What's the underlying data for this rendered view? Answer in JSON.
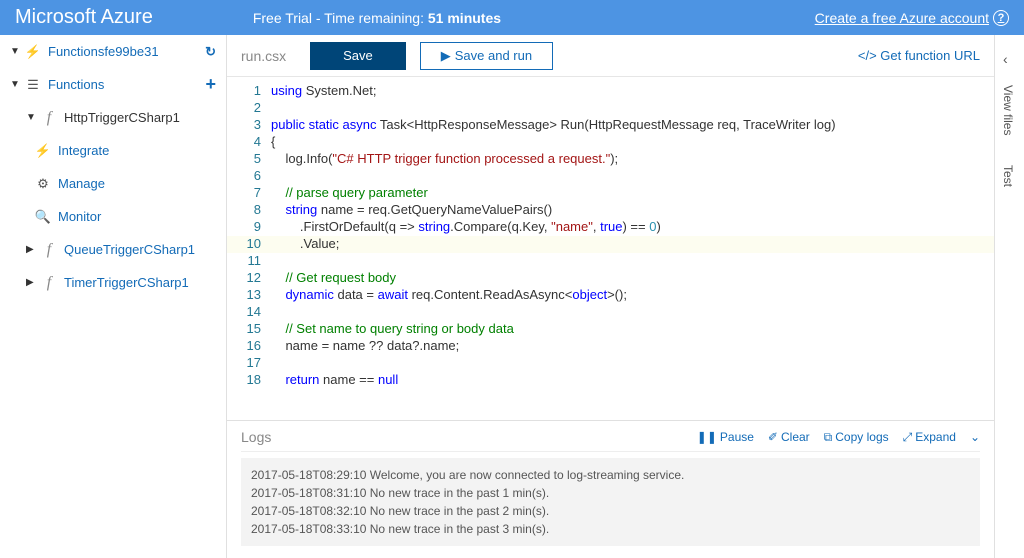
{
  "topbar": {
    "brand": "Microsoft Azure",
    "trial_prefix": "Free Trial - Time remaining: ",
    "trial_time": "51 minutes",
    "create_link": "Create a free Azure account"
  },
  "sidebar": {
    "app_name": "Functionsfe99be31",
    "functions_label": "Functions",
    "items": [
      {
        "label": "HttpTriggerCSharp1",
        "expanded": true,
        "children": [
          {
            "label": "Integrate",
            "icon": "bolt"
          },
          {
            "label": "Manage",
            "icon": "gear"
          },
          {
            "label": "Monitor",
            "icon": "search"
          }
        ]
      },
      {
        "label": "QueueTriggerCSharp1",
        "expanded": false
      },
      {
        "label": "TimerTriggerCSharp1",
        "expanded": false
      }
    ]
  },
  "toolbar": {
    "filename": "run.csx",
    "save_label": "Save",
    "saverun_label": "Save and run",
    "funcurl_label": "</> Get function URL"
  },
  "editor": {
    "lines": [
      {
        "n": 1,
        "html": "<span class='kw'>using</span> System.Net;"
      },
      {
        "n": 2,
        "html": ""
      },
      {
        "n": 3,
        "html": "<span class='kw'>public static async</span> Task&lt;HttpResponseMessage&gt; Run(HttpRequestMessage req, TraceWriter log)"
      },
      {
        "n": 4,
        "html": "{"
      },
      {
        "n": 5,
        "html": "    log.Info(<span class='str'>\"C# HTTP trigger function processed a request.\"</span>);"
      },
      {
        "n": 6,
        "html": ""
      },
      {
        "n": 7,
        "html": "    <span class='cm'>// parse query parameter</span>"
      },
      {
        "n": 8,
        "html": "    <span class='kw'>string</span> name = req.GetQueryNameValuePairs()"
      },
      {
        "n": 9,
        "html": "        .FirstOrDefault(q =&gt; <span class='kw'>string</span>.Compare(q.Key, <span class='str'>\"name\"</span>, <span class='kw'>true</span>) == <span class='ty'>0</span>)"
      },
      {
        "n": 10,
        "html": "        .Value;",
        "hl": true
      },
      {
        "n": 11,
        "html": ""
      },
      {
        "n": 12,
        "html": "    <span class='cm'>// Get request body</span>"
      },
      {
        "n": 13,
        "html": "    <span class='kw'>dynamic</span> data = <span class='kw'>await</span> req.Content.ReadAsAsync&lt;<span class='kw'>object</span>&gt;();"
      },
      {
        "n": 14,
        "html": ""
      },
      {
        "n": 15,
        "html": "    <span class='cm'>// Set name to query string or body data</span>"
      },
      {
        "n": 16,
        "html": "    name = name ?? data?.name;"
      },
      {
        "n": 17,
        "html": ""
      },
      {
        "n": 18,
        "html": "    <span class='kw'>return</span> name == <span class='kw'>null</span>"
      }
    ]
  },
  "logs": {
    "title": "Logs",
    "actions": {
      "pause": "Pause",
      "clear": "Clear",
      "copy": "Copy logs",
      "expand": "Expand"
    },
    "entries": [
      {
        "ts": "2017-05-18T08:29:10",
        "msg": "Welcome, you are now connected to log-streaming service."
      },
      {
        "ts": "2017-05-18T08:31:10",
        "msg": "No new trace in the past 1 min(s)."
      },
      {
        "ts": "2017-05-18T08:32:10",
        "msg": "No new trace in the past 2 min(s)."
      },
      {
        "ts": "2017-05-18T08:33:10",
        "msg": "No new trace in the past 3 min(s)."
      }
    ]
  },
  "rightbar": {
    "tab_files": "View files",
    "tab_test": "Test"
  }
}
